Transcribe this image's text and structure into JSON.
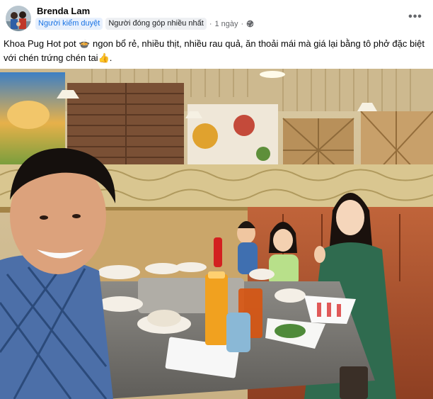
{
  "post": {
    "author": "Brenda Lam",
    "badges": [
      "Người kiểm duyệt",
      "Người đóng góp nhiều nhất"
    ],
    "separator": "·",
    "time": "1 ngày",
    "privacy_icon": "globe-icon",
    "more_icon": "more-options-icon",
    "more_label": "•••",
    "caption": "Khoa Pug Hot pot 🍲 ngon bổ rẻ, nhiều thịt, nhiều rau quả, ăn thoải mái mà giá lại bằng tô phở đặc biệt với chén trứng chén tai👍.",
    "photo_description_icon": "photo"
  },
  "colors": {
    "moderator_badge_bg": "#e7f0fd",
    "moderator_badge_text": "#1b74e4",
    "contributor_badge_bg": "#eef0f3",
    "secondary_text": "#65676b"
  }
}
